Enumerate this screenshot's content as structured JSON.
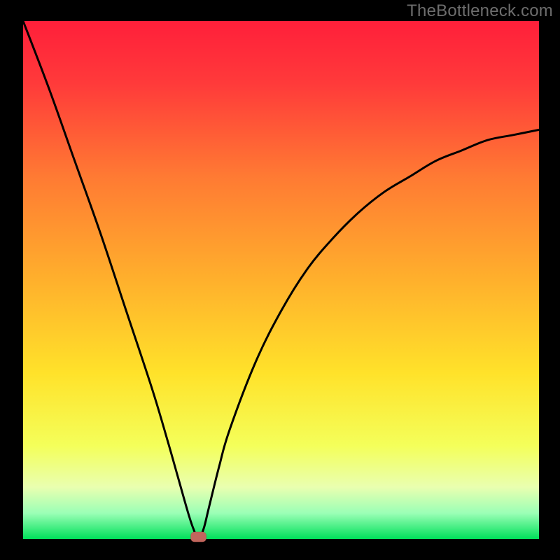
{
  "watermark": "TheBottleneck.com",
  "chart_data": {
    "type": "line",
    "title": "",
    "xlabel": "",
    "ylabel": "",
    "xlim": [
      0,
      100
    ],
    "ylim": [
      0,
      100
    ],
    "curve_description": "V-shaped bottleneck curve with minimum near x≈34",
    "x": [
      0,
      5,
      10,
      15,
      20,
      25,
      28,
      30,
      32,
      33,
      34,
      35,
      36,
      38,
      40,
      45,
      50,
      55,
      60,
      65,
      70,
      75,
      80,
      85,
      90,
      95,
      100
    ],
    "values": [
      100,
      87,
      73,
      59,
      44,
      29,
      19,
      12,
      5,
      2,
      0,
      2,
      6,
      14,
      21,
      34,
      44,
      52,
      58,
      63,
      67,
      70,
      73,
      75,
      77,
      78,
      79
    ],
    "colors": {
      "gradient_top": "#ff1f3a",
      "gradient_mid": "#ffd400",
      "gradient_low": "#f6ff8a",
      "gradient_bottom": "#00e05a",
      "frame": "#000000",
      "curve": "#000000",
      "marker": "#c1665d"
    },
    "marker": {
      "x": 34,
      "y": 0
    }
  }
}
